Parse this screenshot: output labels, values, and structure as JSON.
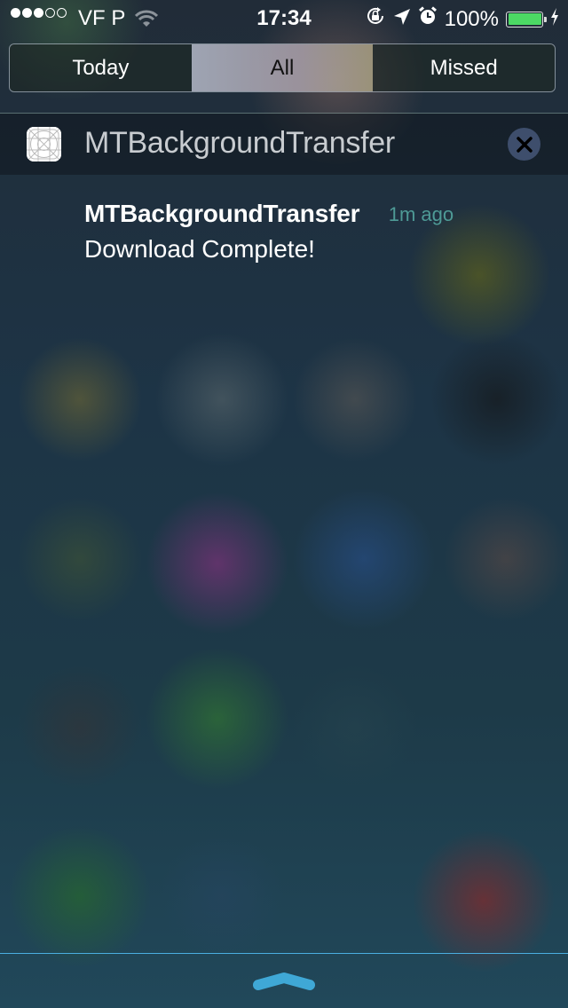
{
  "status_bar": {
    "signal_bars_filled": 3,
    "signal_bars_total": 5,
    "carrier": "VF P",
    "time": "17:34",
    "battery_percent": "100%",
    "battery_level": 1.0,
    "icons": [
      "wifi-icon",
      "rotation-lock-icon",
      "location-icon",
      "alarm-icon",
      "battery-icon",
      "charging-icon"
    ]
  },
  "tabs": [
    {
      "label": "Today",
      "selected": false
    },
    {
      "label": "All",
      "selected": true
    },
    {
      "label": "Missed",
      "selected": false
    }
  ],
  "section": {
    "app_name": "MTBackgroundTransfer",
    "clear_icon": "close-icon"
  },
  "notifications": [
    {
      "title": "MTBackgroundTransfer",
      "time": "1m ago",
      "body": "Download Complete!"
    }
  ],
  "colors": {
    "battery": "#4cd964",
    "timestamp": "#4e9a96",
    "grabber": "#3fa8d6",
    "clear_button": "#3e4e6c"
  }
}
